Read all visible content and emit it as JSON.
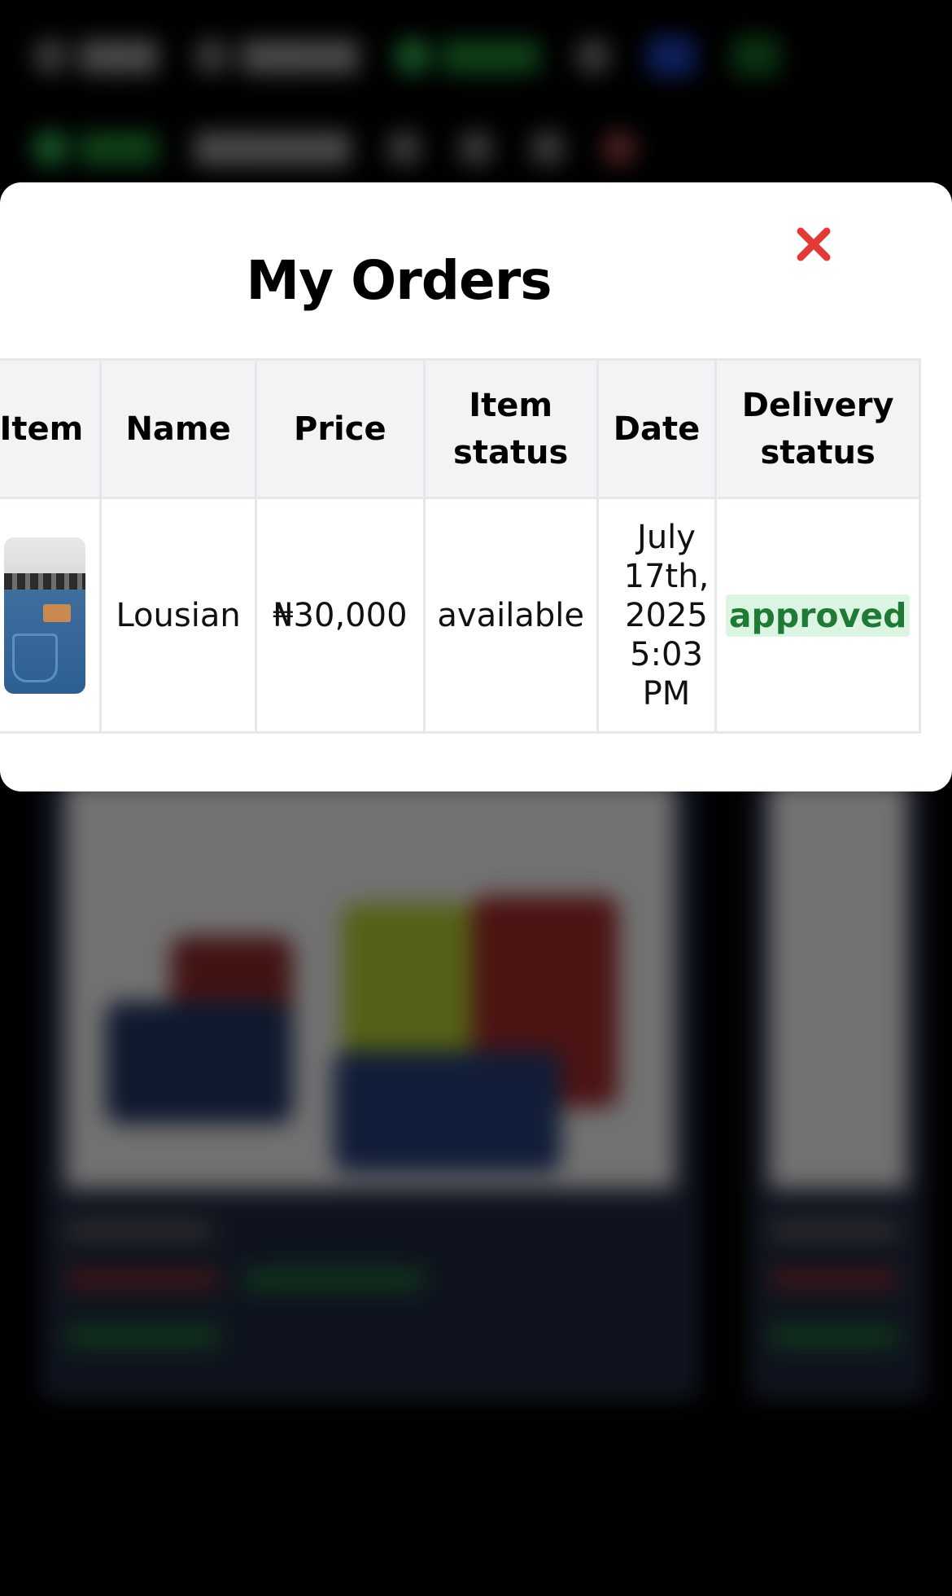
{
  "modal": {
    "title": "My Orders",
    "close_icon": "close-icon"
  },
  "table": {
    "headers": [
      "Item",
      "Name",
      "Price",
      "Item status",
      "Date",
      "Delivery status"
    ],
    "rows": [
      {
        "item_image": "jeans-thumbnail",
        "name": "Lousian",
        "price": "₦30,000",
        "item_status": "available",
        "date": [
          "July",
          "17th,",
          "2025",
          "5:03",
          "PM"
        ],
        "delivery_status": "approved"
      }
    ]
  },
  "colors": {
    "close": "#e53935",
    "available": "#2e8b3e",
    "approved_text": "#1f7a35",
    "approved_bg": "#dcf5e2",
    "header_bg": "#f2f3f5"
  }
}
